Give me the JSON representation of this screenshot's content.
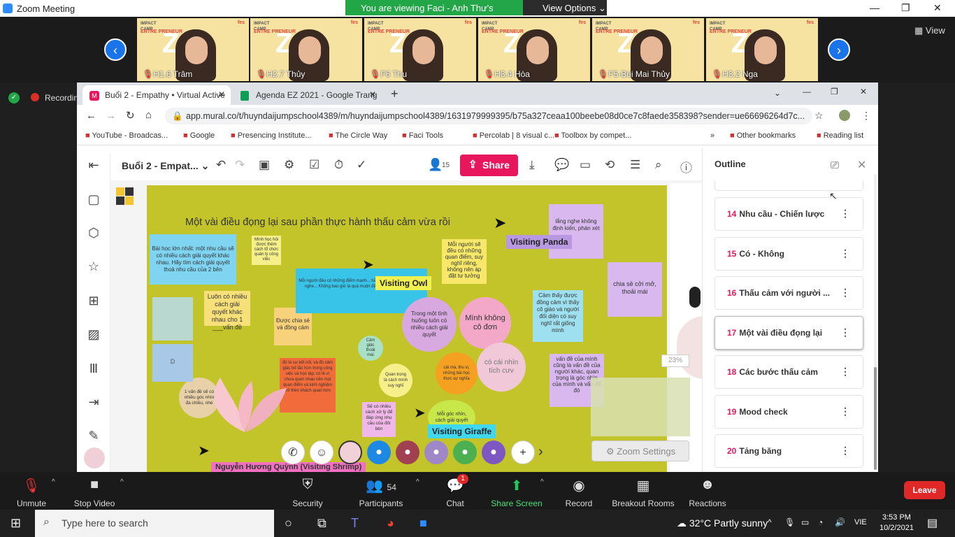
{
  "zoom": {
    "title": "Zoom Meeting",
    "viewing": "You are viewing Faci - Anh Thư's screen",
    "view_options": "View Options",
    "view": "View",
    "recording": "Recording"
  },
  "participants": [
    "H1.6 Trâm",
    "H2.7 Thủy",
    "F6 Thu",
    "H3.4 Hòa",
    "F5-Bùi Mai Thủy",
    "H3.2 Nga"
  ],
  "thumb_caption": {
    "camp": "IMPACT CAMP",
    "ent": "ENTRE PRENEUR",
    "z": "Z",
    "logo": "fes"
  },
  "browser": {
    "tabs": [
      {
        "label": "Buổi 2 - Empathy • Virtual Active",
        "active": true
      },
      {
        "label": "Agenda EZ 2021 - Google Trang",
        "active": false
      }
    ],
    "new_tab": "+",
    "url": "app.mural.co/t/huyndaijumpschool4389/m/huyndaijumpschool4389/1631979999395/b75a327ceaa100beebe08d0ce7c8faede358398?sender=ue66696264d7c...",
    "bookmarks": [
      "YouTube - Broadcas...",
      "Google",
      "Presencing Institute...",
      "The Circle Way",
      "Faci Tools",
      "Percolab | 8 visual c...",
      "Toolbox by compet...",
      "Other bookmarks",
      "Reading list"
    ]
  },
  "mural": {
    "board_name": "Buổi 2 - Empat...",
    "share": "Share",
    "member_count": "15",
    "board_title": "Một vài điều đọng lại sau phần thực hành thấu cảm vừa rồi",
    "notes": {
      "n1": "Bài học lớn nhất: một nhu cầu sẽ có nhiều cách giải quyết khác nhau. Hãy tìm cách giải quyết thoả nhu cầu của 2 bên",
      "n2": "Mình học hỏi được thêm cách tổ chức quản lý công việc",
      "n3": "Mỗi người sẽ đều có những quan điểm, suy nghĩ riêng, không nên áp đặt tư tưởng",
      "n4": "lắng nghe không định kiến, phán xét",
      "n5": "Luôn có nhiều cách giải quyết khác nhau cho 1 ___vấn đề",
      "n6": "Được chia sẻ và đồng cảm",
      "n7": "Mỗi người đều có những điểm mạnh... hãy luôn cởi mở và biết lắng nghe... Không bao giờ là quá muộn để bắt đầu một việc gì đó",
      "n8": "Trong một tình huống luôn có nhiều cách giải quyết",
      "n9": "Mình không cô đơn",
      "n10": "Cảm thấy được đồng cảm vì thấy cô giáo và người đối diện có suy nghĩ rất giống mình",
      "n11": "chia sẻ cởi mở, thoải mái",
      "n12": "có cái nhìn tích cưv",
      "n13": "đó là sự kết nối, và đó cảm giác bế tắc hơn trong công việc và học tập, có lẽ vì chưa quen nhau nên mọi quan điểm và kinh nghiệm trở thèn khách quan hơn",
      "n14": "cái mà, thu vị, những bài học thực sự nghĩa",
      "n15": "vấn đề của mình cũng là vấn đề của người khác, quan trọng là góc nhìn của mình và vấn đề đó",
      "n16": "Quan trọng là cách mình suy nghĩ",
      "n17": "Sẽ có nhiều cách xử lý để đáp ứng nhu cầu của đôi bên",
      "n18": "Mỗi góc nhìn, cách giải quyết",
      "n19": "1 vấn đề sẽ có nhiều góc nhìn đa chiều, nhé",
      "n20": "Cảm giác thoải mái",
      "n21": "D"
    },
    "visitors": [
      "Visiting Panda",
      "Visiting Owl",
      "Visiting Giraffe",
      "Nguyễn Hương Quỳnh (Visiting Shrimp)"
    ],
    "zoom_settings": "Zoom Settings",
    "zoom_pct": "23%"
  },
  "outline": {
    "title": "Outline",
    "items": [
      {
        "num": "14",
        "label": "Nhu cầu - Chiến lược"
      },
      {
        "num": "15",
        "label": "Có - Không"
      },
      {
        "num": "16",
        "label": "Thấu cảm với người ..."
      },
      {
        "num": "17",
        "label": "Một vài điều đọng lại"
      },
      {
        "num": "18",
        "label": "Các bước thấu cảm"
      },
      {
        "num": "19",
        "label": "Mood check"
      },
      {
        "num": "20",
        "label": "Tảng băng"
      }
    ]
  },
  "controls": {
    "unmute": "Unmute",
    "stop_video": "Stop Video",
    "security": "Security",
    "participants": "Participants",
    "participants_count": "54",
    "chat": "Chat",
    "chat_badge": "1",
    "share_screen": "Share Screen",
    "record": "Record",
    "breakout": "Breakout Rooms",
    "reactions": "Reactions",
    "leave": "Leave"
  },
  "taskbar": {
    "search": "Type here to search",
    "weather": "32°C  Partly sunny",
    "lang": "VIE",
    "time": "3:53 PM",
    "date": "10/2/2021"
  }
}
